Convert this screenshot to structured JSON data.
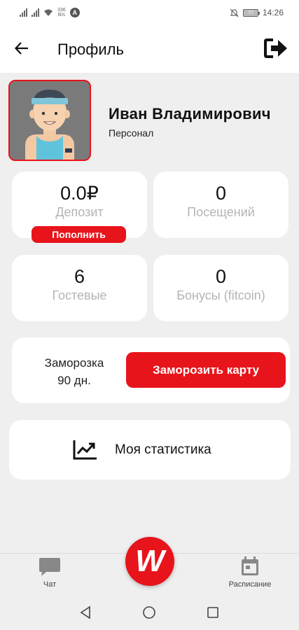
{
  "status_bar": {
    "net_speed": "336",
    "net_unit": "B/s",
    "alert_letter": "A",
    "battery": "77",
    "time": "14:26"
  },
  "header": {
    "title": "Профиль",
    "back_icon": "arrow-left-icon",
    "logout_icon": "logout-icon"
  },
  "profile": {
    "name": "Иван Владимирович",
    "role": "Персонал",
    "avatar_icon": "avatar-illustration"
  },
  "stats": {
    "deposit": {
      "value": "0.0₽",
      "label": "Депозит",
      "action": "Пополнить"
    },
    "visits": {
      "value": "0",
      "label": "Посещений"
    },
    "guests": {
      "value": "6",
      "label": "Гостевые"
    },
    "bonuses": {
      "value": "0",
      "label": "Бонусы (fitcoin)"
    }
  },
  "freeze": {
    "label_line1": "Заморозка",
    "label_line2": "90 дн.",
    "button": "Заморозить карту"
  },
  "statistics": {
    "label": "Моя статистика",
    "icon": "chart-line-icon"
  },
  "bottom_nav": {
    "chat_label": "Чат",
    "schedule_label": "Расписание",
    "brand_letter": "W"
  },
  "colors": {
    "accent": "#e8141b",
    "background": "#efefef",
    "card": "#ffffff",
    "muted_text": "#b5b5b5"
  }
}
